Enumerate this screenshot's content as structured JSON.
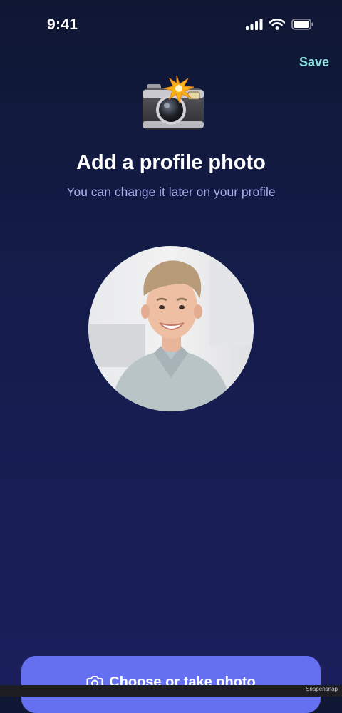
{
  "status_bar": {
    "time": "9:41"
  },
  "header": {
    "save_label": "Save"
  },
  "hero": {
    "emoji": "camera-with-flash-icon"
  },
  "content": {
    "title": "Add a profile photo",
    "subtitle": "You can change it later on your profile"
  },
  "avatar": {
    "alt": "Profile photo"
  },
  "cta": {
    "label": "Choose or take photo",
    "icon": "camera-icon"
  },
  "watermark": "Snapensnap",
  "colors": {
    "accent": "#6470f0",
    "save_text": "#8fe3e0",
    "subtitle_text": "#a9acea",
    "background_top": "#0f1733",
    "background_bottom": "#1a1f5c"
  }
}
